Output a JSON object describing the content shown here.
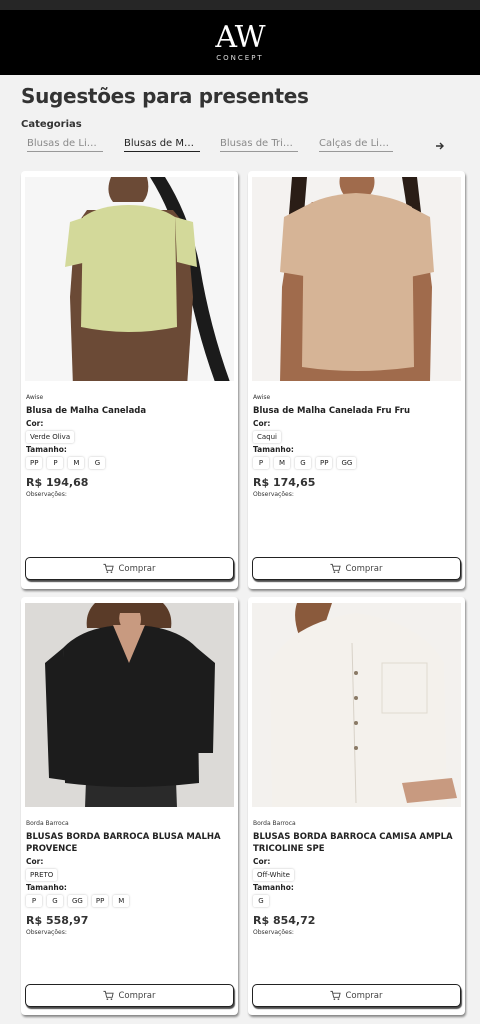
{
  "header": {
    "logo_mark": "AW",
    "logo_sub": "CONCEPT"
  },
  "page": {
    "title": "Sugestões para presentes",
    "categories_label": "Categorias"
  },
  "tabs": [
    {
      "label": "Blusas de Linho",
      "active": false
    },
    {
      "label": "Blusas de Malha",
      "active": true
    },
    {
      "label": "Blusas de Tricot",
      "active": false
    },
    {
      "label": "Calças de Linho",
      "active": false
    }
  ],
  "products": [
    {
      "brand": "Awise",
      "name": "Blusa de Malha Canelada",
      "color_label": "Cor:",
      "color": "Verde Oliva",
      "size_label": "Tamanho:",
      "sizes": [
        "PP",
        "P",
        "M",
        "G"
      ],
      "price": "R$ 194,68",
      "obs_label": "Observações:",
      "buy_label": "Comprar",
      "garment_color": "#d3d99a"
    },
    {
      "brand": "Awise",
      "name": "Blusa de Malha Canelada Fru Fru",
      "color_label": "Cor:",
      "color": "Caqui",
      "size_label": "Tamanho:",
      "sizes": [
        "P",
        "M",
        "G",
        "PP",
        "GG"
      ],
      "price": "R$ 174,65",
      "obs_label": "Observações:",
      "buy_label": "Comprar",
      "garment_color": "#d6b496"
    },
    {
      "brand": "Borda Barroca",
      "name": "BLUSAS BORDA BARROCA BLUSA MALHA PROVENCE",
      "color_label": "Cor:",
      "color": "PRETO",
      "size_label": "Tamanho:",
      "sizes": [
        "P",
        "G",
        "GG",
        "PP",
        "M"
      ],
      "price": "R$ 558,97",
      "obs_label": "Observações:",
      "buy_label": "Comprar",
      "garment_color": "#1c1c1c"
    },
    {
      "brand": "Borda Barroca",
      "name": "BLUSAS BORDA BARROCA CAMISA AMPLA TRICOLINE SPE",
      "color_label": "Cor:",
      "color": "Off-White",
      "size_label": "Tamanho:",
      "sizes": [
        "G"
      ],
      "price": "R$ 854,72",
      "obs_label": "Observações:",
      "buy_label": "Comprar",
      "garment_color": "#f4f1ec"
    }
  ]
}
